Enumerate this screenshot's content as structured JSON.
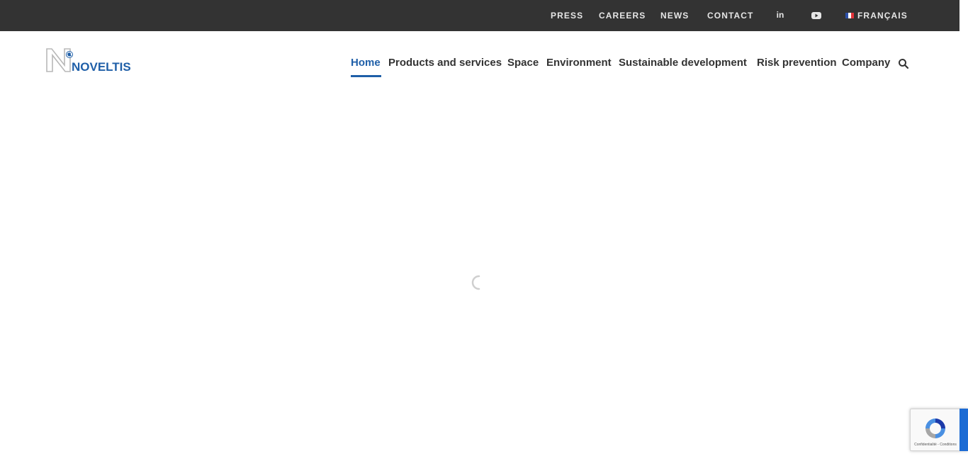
{
  "topbar": {
    "links": {
      "press": "PRESS",
      "careers": "CAREERS",
      "news": "NEWS",
      "contact": "CONTACT"
    },
    "social": {
      "linkedin": "in"
    },
    "language": {
      "label": "FRANÇAIS",
      "flag_icon": "french-flag-icon"
    }
  },
  "header": {
    "logo_text": "NOVELTIS",
    "nav": {
      "home": "Home",
      "products": "Products and services",
      "space": "Space",
      "environment": "Environment",
      "sustainable": "Sustainable development",
      "risk": "Risk prevention",
      "company": "Company"
    }
  },
  "recaptcha": {
    "links": "Confidentialité - Conditions"
  },
  "colors": {
    "topbar_bg": "#333333",
    "accent_blue": "#1f5fa8",
    "nav_text": "#333333"
  },
  "icons": {
    "search": "search-icon",
    "linkedin": "linkedin-icon",
    "youtube": "youtube-icon",
    "spinner": "loading-spinner-icon",
    "recaptcha": "recaptcha-logo-icon"
  }
}
